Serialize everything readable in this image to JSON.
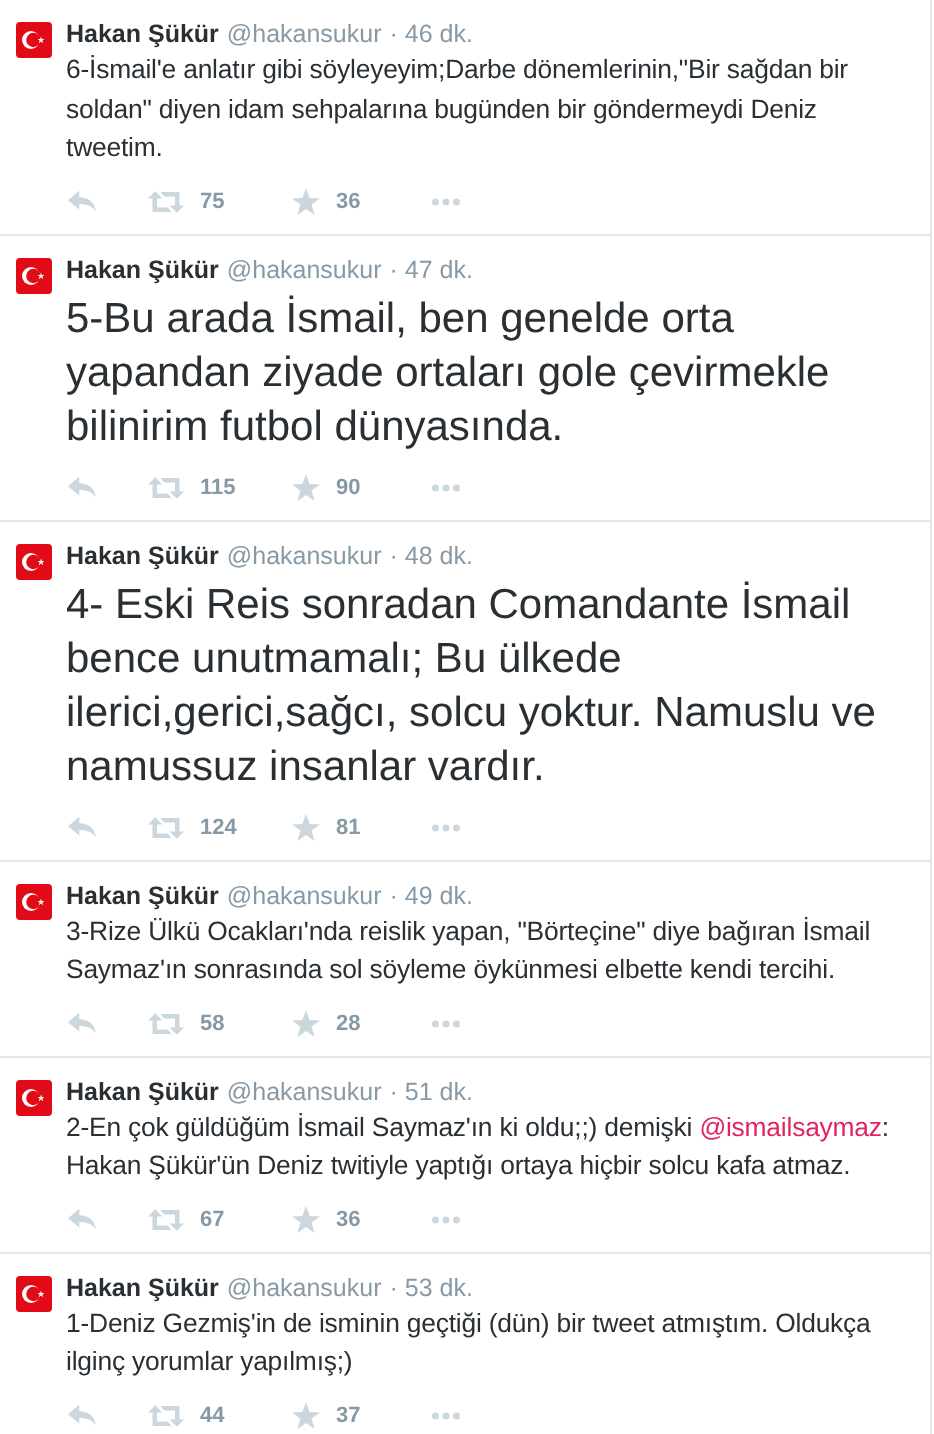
{
  "tweets": [
    {
      "name": "Hakan Şükür",
      "handle": "@hakansukur",
      "time": "· 46 dk.",
      "kind": "normal",
      "text": [
        {
          "kind": "text",
          "value": "6-İsmail'e anlatır gibi söyleyeyim;Darbe dönemlerinin,\"Bir sağdan bir soldan\" diyen idam sehpalarına bugünden bir göndermeydi Deniz tweetim."
        }
      ],
      "retweets": "75",
      "favorites": "36"
    },
    {
      "name": "Hakan Şükür",
      "handle": "@hakansukur",
      "time": "· 47 dk.",
      "kind": "large",
      "text": [
        {
          "kind": "text",
          "value": "5-Bu arada İsmail, ben genelde orta yapandan ziyade ortaları gole çevirmekle bilinirim futbol dünyasında."
        }
      ],
      "retweets": "115",
      "favorites": "90"
    },
    {
      "name": "Hakan Şükür",
      "handle": "@hakansukur",
      "time": "· 48 dk.",
      "kind": "large",
      "text": [
        {
          "kind": "text",
          "value": "4- Eski Reis sonradan Comandante İsmail bence unutmamalı; Bu ülkede ilerici,gerici,sağcı, solcu yoktur. Namuslu ve namussuz insanlar vardır."
        }
      ],
      "retweets": "124",
      "favorites": "81"
    },
    {
      "name": "Hakan Şükür",
      "handle": "@hakansukur",
      "time": "· 49 dk.",
      "kind": "normal",
      "text": [
        {
          "kind": "text",
          "value": "3-Rize Ülkü Ocakları'nda reislik yapan, \"Börteçine\" diye bağıran İsmail Saymaz'ın sonrasında sol söyleme öykünmesi elbette kendi tercihi."
        }
      ],
      "retweets": "58",
      "favorites": "28"
    },
    {
      "name": "Hakan Şükür",
      "handle": "@hakansukur",
      "time": "· 51 dk.",
      "kind": "normal",
      "text": [
        {
          "kind": "text",
          "value": "2-En çok güldüğüm İsmail Saymaz'ın ki oldu;;) demişki "
        },
        {
          "kind": "mention",
          "value": "@ismailsaymaz"
        },
        {
          "kind": "text",
          "value": ": Hakan Şükür'ün Deniz twitiyle yaptığı ortaya hiçbir solcu kafa atmaz."
        }
      ],
      "retweets": "67",
      "favorites": "36"
    },
    {
      "name": "Hakan Şükür",
      "handle": "@hakansukur",
      "time": "· 53 dk.",
      "kind": "normal",
      "text": [
        {
          "kind": "text",
          "value": "1-Deniz Gezmiş'in de isminin geçtiği (dün) bir tweet atmıştım. Oldukça ilginç yorumlar yapılmış;)"
        }
      ],
      "retweets": "44",
      "favorites": "37"
    }
  ]
}
